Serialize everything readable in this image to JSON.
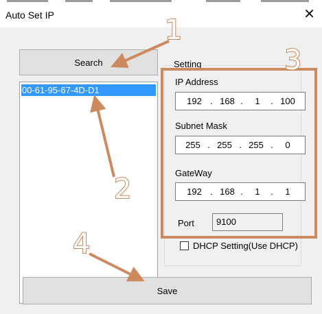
{
  "window": {
    "title": "Auto Set IP",
    "close_glyph": "✕"
  },
  "search_button": {
    "label": "Search"
  },
  "device_list": {
    "items": [
      "00-61-95-67-4D-D1"
    ]
  },
  "setting": {
    "group_label": "Setting",
    "ip_label": "IP Address",
    "ip": [
      "192",
      "168",
      "1",
      "100"
    ],
    "subnet_label": "Subnet Mask",
    "subnet": [
      "255",
      "255",
      "255",
      "0"
    ],
    "gateway_label": "GateWay",
    "gateway": [
      "192",
      "168",
      "1",
      "1"
    ],
    "port_label": "Port",
    "port_value": "9100",
    "dhcp_label": "DHCP Setting(Use DHCP)",
    "dhcp_checked": false
  },
  "save_button": {
    "label": "Save"
  },
  "annotations": {
    "numbers": [
      "1",
      "2",
      "3",
      "4"
    ],
    "color": "#cd8a5e"
  }
}
